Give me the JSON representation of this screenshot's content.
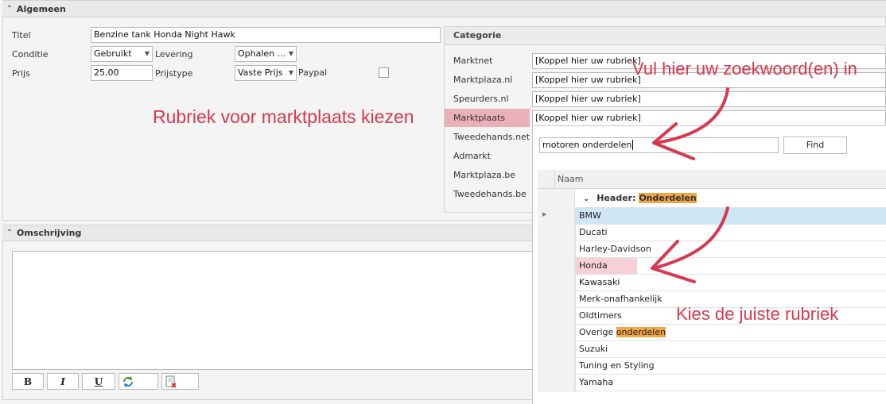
{
  "algemeen": {
    "title": "Algemeen",
    "titel_label": "Titel",
    "titel_value": "Benzine tank Honda Night Hawk",
    "conditie_label": "Conditie",
    "conditie_value": "Gebruikt",
    "levering_label": "Levering",
    "levering_value": "Ophalen ...",
    "prijs_label": "Prijs",
    "prijs_value": "25,00",
    "prijstype_label": "Prijstype",
    "prijstype_value": "Vaste Prijs",
    "paypal_label": "Paypal",
    "paypal_checked": false
  },
  "categorie": {
    "title": "Categorie",
    "items": [
      {
        "name": "Marktnet",
        "value": "[Koppel hier uw rubriek]"
      },
      {
        "name": "Marktplaza.nl",
        "value": "[Koppel hier uw rubriek]"
      },
      {
        "name": "Speurders.nl",
        "value": "[Koppel hier uw rubriek]"
      },
      {
        "name": "Marktplaats",
        "value": "[Koppel hier uw rubriek]"
      },
      {
        "name": "Tweedehands.net"
      },
      {
        "name": "Admarkt"
      },
      {
        "name": "Marktplaza.be"
      },
      {
        "name": "Tweedehands.be"
      }
    ],
    "search_value": "motoren onderdelen",
    "find_label": "Find",
    "grid_column": "Naam",
    "group_prefix": "Header:",
    "group_name": "Onderdelen",
    "rows": [
      "BMW",
      "Ducati",
      "Harley-Davidson",
      "Honda",
      "Kawasaki",
      "Merk-onafhankelijk",
      "Oldtimers",
      "Overige",
      "Suzuki",
      "Tuning en Styling",
      "Yamaha"
    ],
    "row_highlight": "onderdelen"
  },
  "omschrijving": {
    "title": "Omschrijving",
    "toolbar": {
      "bold": "B",
      "italic": "I",
      "underline": "U"
    }
  },
  "annotations": {
    "rubriek": "Rubriek voor marktplaats kiezen",
    "zoekwoord": "Vul hier uw zoekwoord(en) in",
    "kies": "Kies de juiste rubriek"
  },
  "colors": {
    "annotation": "#d6394f",
    "selected_category": "#eab0b8",
    "selected_row": "#cfe6f7",
    "match_highlight": "#f2a544"
  }
}
